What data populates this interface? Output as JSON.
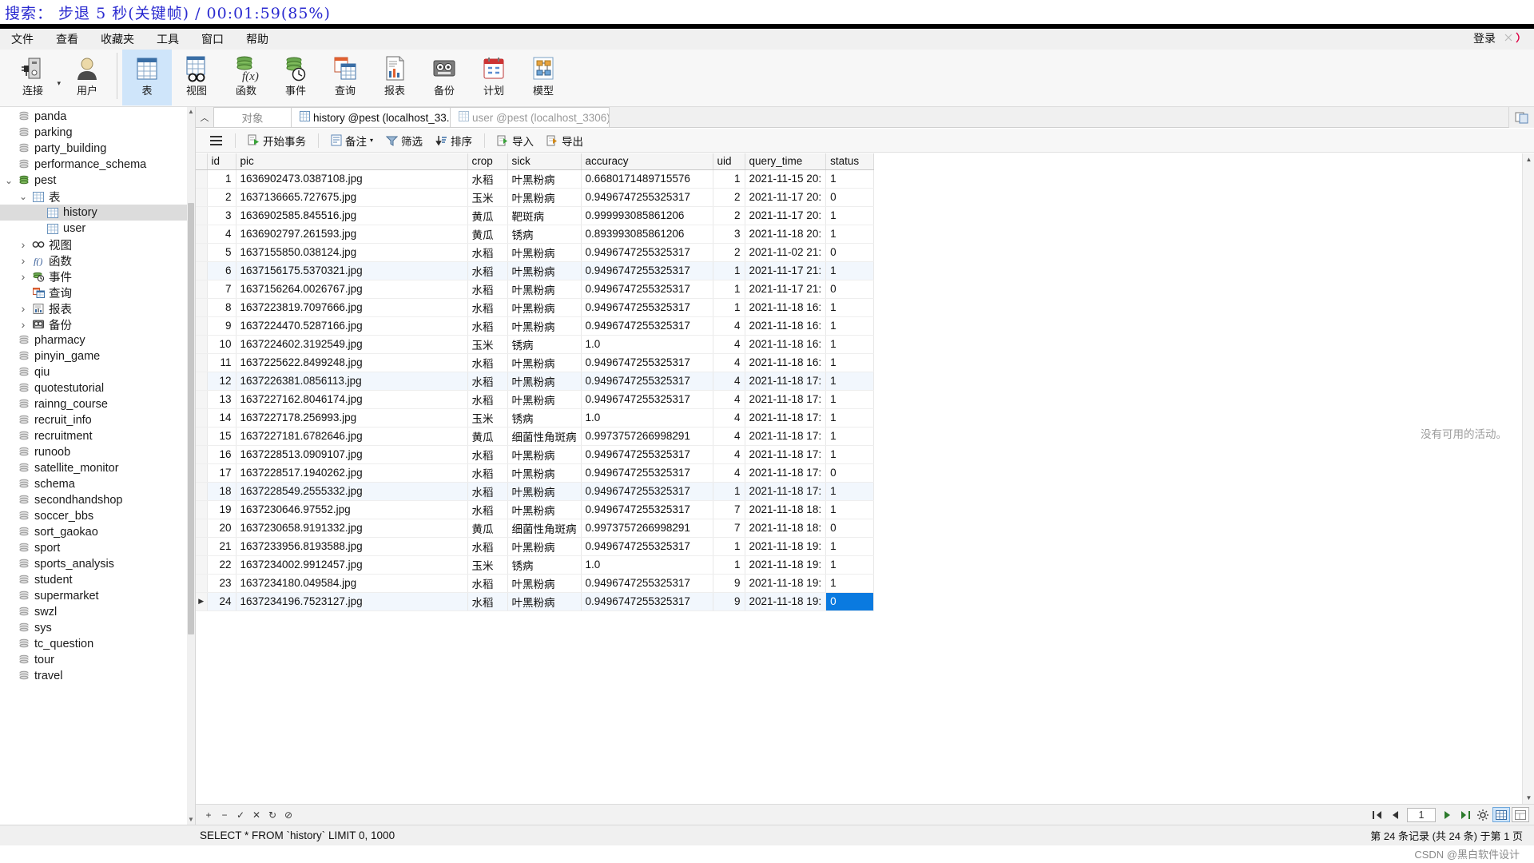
{
  "overlay": {
    "text": "搜索： 步退 5 秒(关键帧) / 00:01:59(85%)"
  },
  "menubar": {
    "items": [
      "文件",
      "查看",
      "收藏夹",
      "工具",
      "窗口",
      "帮助"
    ],
    "login_label": "登录"
  },
  "ribbon": {
    "items": [
      {
        "label": "连接",
        "icon": "connection-icon",
        "active": false,
        "caret": true
      },
      {
        "label": "用户",
        "icon": "user-icon",
        "active": false,
        "caret": false
      },
      {
        "label": "表",
        "icon": "table-icon",
        "active": true,
        "caret": false
      },
      {
        "label": "视图",
        "icon": "view-icon",
        "active": false,
        "caret": false
      },
      {
        "label": "函数",
        "icon": "function-icon",
        "active": false,
        "caret": false
      },
      {
        "label": "事件",
        "icon": "event-icon",
        "active": false,
        "caret": false
      },
      {
        "label": "查询",
        "icon": "query-icon",
        "active": false,
        "caret": false
      },
      {
        "label": "报表",
        "icon": "report-icon",
        "active": false,
        "caret": false
      },
      {
        "label": "备份",
        "icon": "backup-icon",
        "active": false,
        "caret": false
      },
      {
        "label": "计划",
        "icon": "schedule-icon",
        "active": false,
        "caret": false
      },
      {
        "label": "模型",
        "icon": "model-icon",
        "active": false,
        "caret": false
      }
    ]
  },
  "sidebar": {
    "items": [
      {
        "label": "panda",
        "type": "database",
        "depth": 0,
        "twisty": "",
        "selected": false
      },
      {
        "label": "parking",
        "type": "database",
        "depth": 0,
        "twisty": "",
        "selected": false
      },
      {
        "label": "party_building",
        "type": "database",
        "depth": 0,
        "twisty": "",
        "selected": false
      },
      {
        "label": "performance_schema",
        "type": "database",
        "depth": 0,
        "twisty": "",
        "selected": false
      },
      {
        "label": "pest",
        "type": "database-open",
        "depth": 0,
        "twisty": "v",
        "selected": false
      },
      {
        "label": "表",
        "type": "folder-table",
        "depth": 1,
        "twisty": "v",
        "selected": false
      },
      {
        "label": "history",
        "type": "table",
        "depth": 2,
        "twisty": "",
        "selected": true
      },
      {
        "label": "user",
        "type": "table",
        "depth": 2,
        "twisty": "",
        "selected": false
      },
      {
        "label": "视图",
        "type": "folder-view",
        "depth": 1,
        "twisty": ">",
        "selected": false
      },
      {
        "label": "函数",
        "type": "folder-function",
        "depth": 1,
        "twisty": ">",
        "selected": false
      },
      {
        "label": "事件",
        "type": "folder-event",
        "depth": 1,
        "twisty": ">",
        "selected": false
      },
      {
        "label": "查询",
        "type": "folder-query",
        "depth": 1,
        "twisty": "",
        "selected": false
      },
      {
        "label": "报表",
        "type": "folder-report",
        "depth": 1,
        "twisty": ">",
        "selected": false
      },
      {
        "label": "备份",
        "type": "folder-backup",
        "depth": 1,
        "twisty": ">",
        "selected": false
      },
      {
        "label": "pharmacy",
        "type": "database",
        "depth": 0,
        "twisty": "",
        "selected": false
      },
      {
        "label": "pinyin_game",
        "type": "database",
        "depth": 0,
        "twisty": "",
        "selected": false
      },
      {
        "label": "qiu",
        "type": "database",
        "depth": 0,
        "twisty": "",
        "selected": false
      },
      {
        "label": "quotestutorial",
        "type": "database",
        "depth": 0,
        "twisty": "",
        "selected": false
      },
      {
        "label": "rainng_course",
        "type": "database",
        "depth": 0,
        "twisty": "",
        "selected": false
      },
      {
        "label": "recruit_info",
        "type": "database",
        "depth": 0,
        "twisty": "",
        "selected": false
      },
      {
        "label": "recruitment",
        "type": "database",
        "depth": 0,
        "twisty": "",
        "selected": false
      },
      {
        "label": "runoob",
        "type": "database",
        "depth": 0,
        "twisty": "",
        "selected": false
      },
      {
        "label": "satellite_monitor",
        "type": "database",
        "depth": 0,
        "twisty": "",
        "selected": false
      },
      {
        "label": "schema",
        "type": "database",
        "depth": 0,
        "twisty": "",
        "selected": false
      },
      {
        "label": "secondhandshop",
        "type": "database",
        "depth": 0,
        "twisty": "",
        "selected": false
      },
      {
        "label": "soccer_bbs",
        "type": "database",
        "depth": 0,
        "twisty": "",
        "selected": false
      },
      {
        "label": "sort_gaokao",
        "type": "database",
        "depth": 0,
        "twisty": "",
        "selected": false
      },
      {
        "label": "sport",
        "type": "database",
        "depth": 0,
        "twisty": "",
        "selected": false
      },
      {
        "label": "sports_analysis",
        "type": "database",
        "depth": 0,
        "twisty": "",
        "selected": false
      },
      {
        "label": "student",
        "type": "database",
        "depth": 0,
        "twisty": "",
        "selected": false
      },
      {
        "label": "supermarket",
        "type": "database",
        "depth": 0,
        "twisty": "",
        "selected": false
      },
      {
        "label": "swzl",
        "type": "database",
        "depth": 0,
        "twisty": "",
        "selected": false
      },
      {
        "label": "sys",
        "type": "database",
        "depth": 0,
        "twisty": "",
        "selected": false
      },
      {
        "label": "tc_question",
        "type": "database",
        "depth": 0,
        "twisty": "",
        "selected": false
      },
      {
        "label": "tour",
        "type": "database",
        "depth": 0,
        "twisty": "",
        "selected": false
      },
      {
        "label": "travel",
        "type": "database",
        "depth": 0,
        "twisty": "",
        "selected": false
      }
    ]
  },
  "tabs": {
    "object_label": "对象",
    "items": [
      {
        "label": "history @pest (localhost_33...",
        "active": true
      },
      {
        "label": "user @pest (localhost_3306)...",
        "active": false
      }
    ]
  },
  "data_toolbar": {
    "buttons": [
      {
        "label": "开始事务",
        "icon": "transaction-icon"
      },
      {
        "label": "备注",
        "icon": "note-icon",
        "caret": true
      },
      {
        "label": "筛选",
        "icon": "filter-icon"
      },
      {
        "label": "排序",
        "icon": "sort-icon"
      },
      {
        "label": "导入",
        "icon": "import-icon"
      },
      {
        "label": "导出",
        "icon": "export-icon"
      }
    ],
    "menu_icon": "hamburger-icon"
  },
  "grid": {
    "columns": [
      "id",
      "pic",
      "crop",
      "sick",
      "accuracy",
      "uid",
      "query_time",
      "status"
    ],
    "rows": [
      [
        "1",
        "1636902473.0387108.jpg",
        "水稻",
        "叶黑粉病",
        "0.6680171489715576",
        "1",
        "2021-11-15 20:",
        "1"
      ],
      [
        "2",
        "1637136665.727675.jpg",
        "玉米",
        "叶黑粉病",
        "0.9496747255325317",
        "2",
        "2021-11-17 20:",
        "0"
      ],
      [
        "3",
        "1636902585.845516.jpg",
        "黄瓜",
        "靶斑病",
        "0.999993085861206",
        "2",
        "2021-11-17 20:",
        "1"
      ],
      [
        "4",
        "1636902797.261593.jpg",
        "黄瓜",
        "锈病",
        "0.893993085861206",
        "3",
        "2021-11-18 20:",
        "1"
      ],
      [
        "5",
        "1637155850.038124.jpg",
        "水稻",
        "叶黑粉病",
        "0.9496747255325317",
        "2",
        "2021-11-02 21:",
        "0"
      ],
      [
        "6",
        "1637156175.5370321.jpg",
        "水稻",
        "叶黑粉病",
        "0.9496747255325317",
        "1",
        "2021-11-17 21:",
        "1"
      ],
      [
        "7",
        "1637156264.0026767.jpg",
        "水稻",
        "叶黑粉病",
        "0.9496747255325317",
        "1",
        "2021-11-17 21:",
        "0"
      ],
      [
        "8",
        "1637223819.7097666.jpg",
        "水稻",
        "叶黑粉病",
        "0.9496747255325317",
        "1",
        "2021-11-18 16:",
        "1"
      ],
      [
        "9",
        "1637224470.5287166.jpg",
        "水稻",
        "叶黑粉病",
        "0.9496747255325317",
        "4",
        "2021-11-18 16:",
        "1"
      ],
      [
        "10",
        "1637224602.3192549.jpg",
        "玉米",
        "锈病",
        "1.0",
        "4",
        "2021-11-18 16:",
        "1"
      ],
      [
        "11",
        "1637225622.8499248.jpg",
        "水稻",
        "叶黑粉病",
        "0.9496747255325317",
        "4",
        "2021-11-18 16:",
        "1"
      ],
      [
        "12",
        "1637226381.0856113.jpg",
        "水稻",
        "叶黑粉病",
        "0.9496747255325317",
        "4",
        "2021-11-18 17:",
        "1"
      ],
      [
        "13",
        "1637227162.8046174.jpg",
        "水稻",
        "叶黑粉病",
        "0.9496747255325317",
        "4",
        "2021-11-18 17:",
        "1"
      ],
      [
        "14",
        "1637227178.256993.jpg",
        "玉米",
        "锈病",
        "1.0",
        "4",
        "2021-11-18 17:",
        "1"
      ],
      [
        "15",
        "1637227181.6782646.jpg",
        "黄瓜",
        "细菌性角斑病",
        "0.9973757266998291",
        "4",
        "2021-11-18 17:",
        "1"
      ],
      [
        "16",
        "1637228513.0909107.jpg",
        "水稻",
        "叶黑粉病",
        "0.9496747255325317",
        "4",
        "2021-11-18 17:",
        "1"
      ],
      [
        "17",
        "1637228517.1940262.jpg",
        "水稻",
        "叶黑粉病",
        "0.9496747255325317",
        "4",
        "2021-11-18 17:",
        "0"
      ],
      [
        "18",
        "1637228549.2555332.jpg",
        "水稻",
        "叶黑粉病",
        "0.9496747255325317",
        "1",
        "2021-11-18 17:",
        "1"
      ],
      [
        "19",
        "1637230646.97552.jpg",
        "水稻",
        "叶黑粉病",
        "0.9496747255325317",
        "7",
        "2021-11-18 18:",
        "1"
      ],
      [
        "20",
        "1637230658.9191332.jpg",
        "黄瓜",
        "细菌性角斑病",
        "0.9973757266998291",
        "7",
        "2021-11-18 18:",
        "0"
      ],
      [
        "21",
        "1637233956.8193588.jpg",
        "水稻",
        "叶黑粉病",
        "0.9496747255325317",
        "1",
        "2021-11-18 19:",
        "1"
      ],
      [
        "22",
        "1637234002.9912457.jpg",
        "玉米",
        "锈病",
        "1.0",
        "1",
        "2021-11-18 19:",
        "1"
      ],
      [
        "23",
        "1637234180.049584.jpg",
        "水稻",
        "叶黑粉病",
        "0.9496747255325317",
        "9",
        "2021-11-18 19:",
        "1"
      ],
      [
        "24",
        "1637234196.7523127.jpg",
        "水稻",
        "叶黑粉病",
        "0.9496747255325317",
        "9",
        "2021-11-18 19:",
        "0"
      ]
    ],
    "selected_row_index": 23,
    "selected_column_index": 7,
    "empty_activity_note": "没有可用的活动。"
  },
  "grid_nav": {
    "add_label": "+",
    "remove_label": "−",
    "confirm_label": "✓",
    "cancel_label": "✕",
    "refresh_label": "↻",
    "stop_label": "⊘",
    "page_value": "1",
    "first_icon": "first-page-icon",
    "prev_icon": "prev-page-icon",
    "next_icon": "next-page-icon",
    "last_icon": "last-page-icon",
    "settings_icon": "gear-icon",
    "grid_view_icon": "grid-view-icon",
    "form_view_icon": "form-view-icon"
  },
  "statusbar": {
    "sql": "SELECT * FROM `history` LIMIT 0, 1000",
    "record_info": "第 24 条记录 (共 24 条) 于第 1 页"
  },
  "watermark": {
    "text": "CSDN @黑白软件设计"
  },
  "colors": {
    "accent": "#0a7ae0",
    "ribbon_active": "#cfe5fa",
    "tree_selected": "#dcdcdc",
    "alt_row": "#f2f7fd",
    "overlay_text": "#2a2ad0"
  }
}
